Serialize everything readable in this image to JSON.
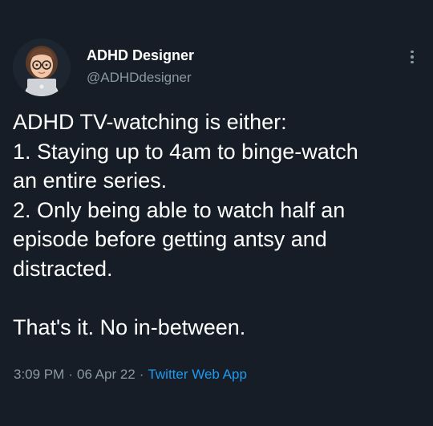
{
  "author": {
    "display_name": "ADHD Designer",
    "handle": "@ADHDdesigner"
  },
  "tweet": {
    "lines": [
      "ADHD TV-watching is either:",
      "1. Staying up to 4am to binge-watch",
      "an entire series.",
      "2. Only being able to watch half an",
      "episode before getting antsy and",
      "distracted.",
      "",
      "That's it. No in-between."
    ]
  },
  "meta": {
    "time": "3:09 PM",
    "separator": "·",
    "date": "06 Apr 22",
    "source": "Twitter Web App"
  },
  "icons": {
    "more": "more-vertical-icon",
    "avatar": "memoji-with-laptop-avatar"
  },
  "colors": {
    "background": "#15202b",
    "primary_text": "#ffffff",
    "secondary_text": "#8b98a5",
    "link": "#1d9bf0"
  }
}
